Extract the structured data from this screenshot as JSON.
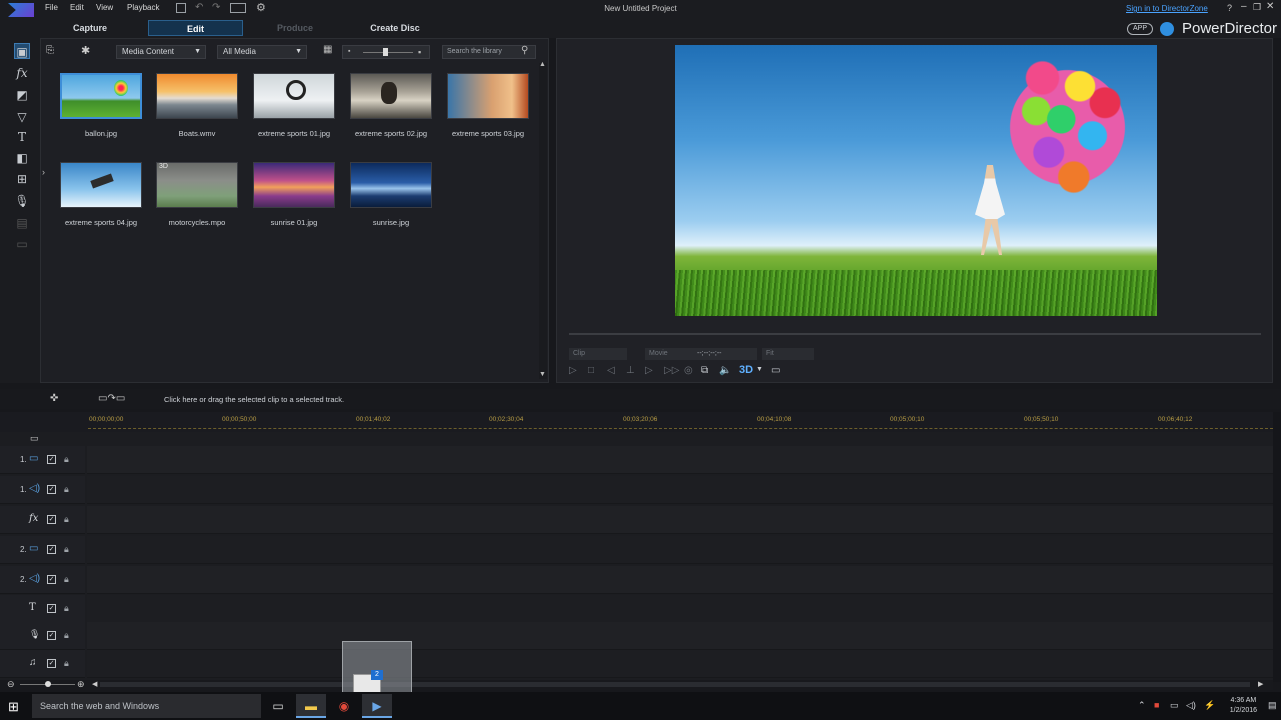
{
  "window": {
    "title": "New Untitled Project",
    "menu": [
      "File",
      "Edit",
      "View",
      "Playback"
    ],
    "signin_link": "Sign in to DirectorZone",
    "help": "?",
    "app_badge": "APP",
    "brand": "PowerDirector"
  },
  "modes": [
    {
      "label": "Capture",
      "state": "normal"
    },
    {
      "label": "Edit",
      "state": "active"
    },
    {
      "label": "Produce",
      "state": "disabled"
    },
    {
      "label": "Create Disc",
      "state": "normal"
    }
  ],
  "library": {
    "content_filter": "Media Content",
    "media_filter": "All Media",
    "search_placeholder": "Search the library",
    "items": [
      {
        "name": "ballon.jpg",
        "selected": true
      },
      {
        "name": "Boats.wmv",
        "selected": false
      },
      {
        "name": "extreme sports 01.jpg",
        "selected": false
      },
      {
        "name": "extreme sports 02.jpg",
        "selected": false
      },
      {
        "name": "extreme sports 03.jpg",
        "selected": false
      },
      {
        "name": "extreme sports 04.jpg",
        "selected": false
      },
      {
        "name": "motorcycles.mpo",
        "selected": false
      },
      {
        "name": "sunrise 01.jpg",
        "selected": false
      },
      {
        "name": "sunrise.jpg",
        "selected": false
      }
    ]
  },
  "preview": {
    "clip_label": "Clip",
    "movie_label": "Movie",
    "timecode": "--;--;--;--",
    "zoom": "Fit",
    "threeD_label": "3D"
  },
  "timeline": {
    "hint": "Click here or drag the selected clip to a selected track.",
    "ruler": [
      "00;00;00;00",
      "00;00;50;00",
      "00;01;40;02",
      "00;02;30;04",
      "00;03;20;06",
      "00;04;10;08",
      "00;05;00;10",
      "00;05;50;10",
      "00;06;40;12"
    ],
    "tracks": [
      {
        "num": "1.",
        "icon": "video-track-icon",
        "glyph": "▭"
      },
      {
        "num": "1.",
        "icon": "audio-track-icon",
        "glyph": "◁)"
      },
      {
        "num": "",
        "icon": "fx-track-icon",
        "glyph": "fx"
      },
      {
        "num": "2.",
        "icon": "video-track-icon",
        "glyph": "▭"
      },
      {
        "num": "2.",
        "icon": "audio-track-icon",
        "glyph": "◁)"
      },
      {
        "num": "",
        "icon": "title-track-icon",
        "glyph": "T"
      },
      {
        "num": "",
        "icon": "voice-track-icon",
        "glyph": "🎙"
      },
      {
        "num": "",
        "icon": "music-track-icon",
        "glyph": "♫"
      }
    ]
  },
  "taskbar": {
    "search_placeholder": "Search the web and Windows",
    "time": "4:36 AM",
    "date": "1/2/2016",
    "drag_badge": "2"
  },
  "colors": {
    "accent": "#3e8ed8",
    "background": "#17181c",
    "ruler_text": "#b89d45"
  }
}
